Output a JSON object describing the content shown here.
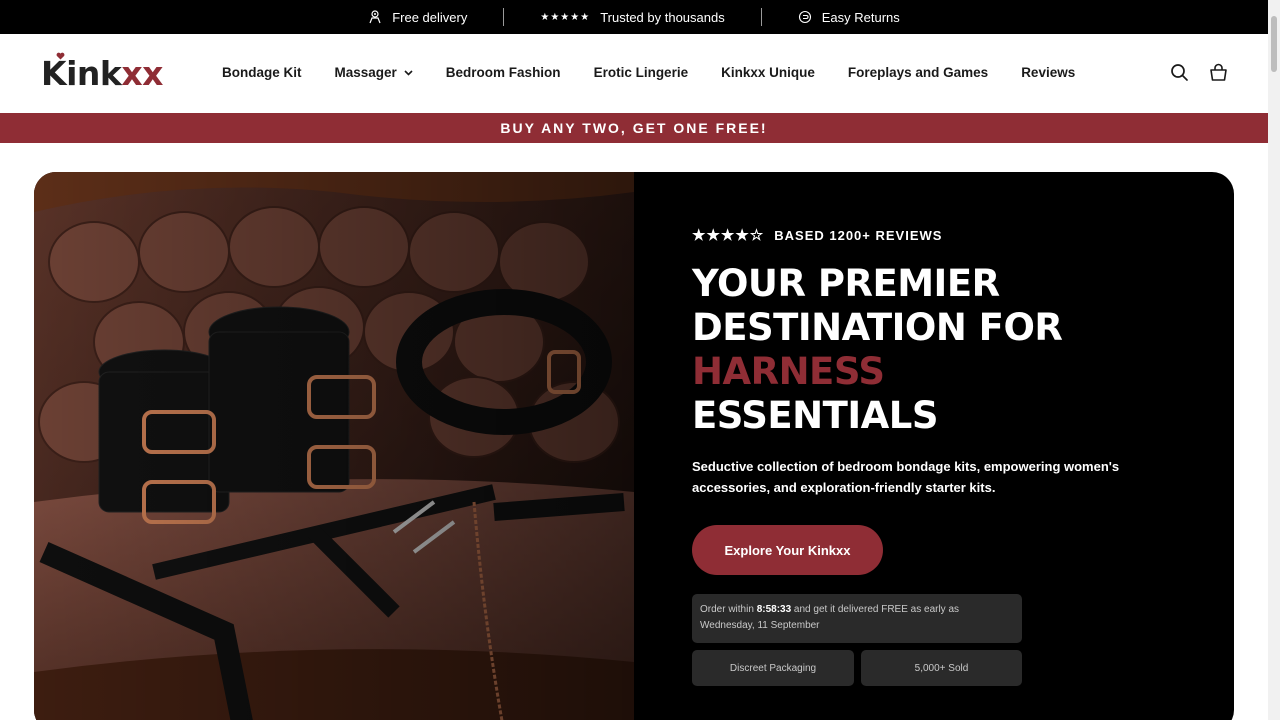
{
  "announcement": {
    "items": [
      {
        "icon": "delivery-icon",
        "text": "Free delivery"
      },
      {
        "icon": "stars-icon",
        "stars": "★★★★★",
        "text": "Trusted by thousands"
      },
      {
        "icon": "returns-icon",
        "text": "Easy Returns"
      }
    ]
  },
  "header": {
    "logo_main": "Kink",
    "logo_accent": "xx",
    "nav": [
      {
        "label": "Bondage Kit"
      },
      {
        "label": "Massager",
        "has_dropdown": true
      },
      {
        "label": "Bedroom Fashion"
      },
      {
        "label": "Erotic Lingerie"
      },
      {
        "label": "Kinkxx Unique"
      },
      {
        "label": "Foreplays and Games"
      },
      {
        "label": "Reviews"
      }
    ],
    "icons": [
      "search-icon",
      "cart-icon"
    ]
  },
  "promo": {
    "text": "BUY ANY TWO, GET ONE FREE!"
  },
  "hero": {
    "rating_stars": "★★★★☆",
    "rating_value": 4.5,
    "rating_text": "BASED 1200+ REVIEWS",
    "headline_line1": "YOUR PREMIER",
    "headline_line2": "DESTINATION FOR",
    "headline_accent": "HARNESS",
    "headline_line4": "ESSENTIALS",
    "description": "Seductive collection of bedroom bondage kits, empowering women's accessories, and exploration-friendly starter kits.",
    "cta_label": "Explore Your Kinkxx",
    "order_prefix": "Order within ",
    "order_time": "8:58:33",
    "order_suffix": " and get it delivered FREE as early as Wednesday, 11 September",
    "chip_packaging": "Discreet Packaging",
    "chip_sold": "5,000+ Sold"
  },
  "colors": {
    "brand": "#8f2d35",
    "dark": "#000000",
    "chip_bg": "#2a2a2a"
  }
}
